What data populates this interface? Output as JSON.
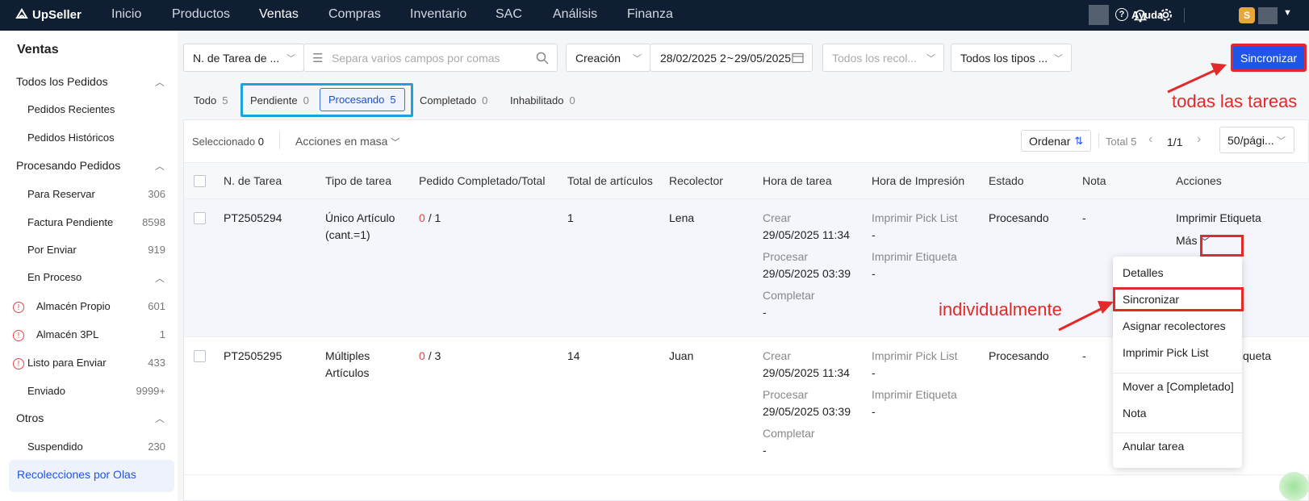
{
  "topbar": {
    "logo": "UpSeller",
    "nav": [
      "Inicio",
      "Productos",
      "Ventas",
      "Compras",
      "Inventario",
      "SAC",
      "Análisis",
      "Finanza"
    ],
    "help": "Ayuda",
    "user_badge": "S"
  },
  "sidebar": {
    "title": "Ventas",
    "items": [
      {
        "label": "Todos los Pedidos",
        "count": ""
      },
      {
        "label": "Pedidos Recientes",
        "count": ""
      },
      {
        "label": "Pedidos Históricos",
        "count": ""
      },
      {
        "label": "Procesando Pedidos",
        "count": ""
      },
      {
        "label": "Para Reservar",
        "count": "306"
      },
      {
        "label": "Factura Pendiente",
        "count": "8598"
      },
      {
        "label": "Por Enviar",
        "count": "919"
      },
      {
        "label": "En Proceso",
        "count": ""
      },
      {
        "label": "Almacén Propio",
        "count": "601"
      },
      {
        "label": "Almacén 3PL",
        "count": "1"
      },
      {
        "label": "Listo para Enviar",
        "count": "433"
      },
      {
        "label": "Enviado",
        "count": "9999+"
      },
      {
        "label": "Otros",
        "count": ""
      },
      {
        "label": "Suspendido",
        "count": "230"
      },
      {
        "label": "Recolecciones por Olas",
        "count": ""
      }
    ]
  },
  "filters": {
    "task_no": "N. de Tarea de ...",
    "search_placeholder": "Separa varios campos por comas",
    "date_type": "Creación",
    "date_start": "28/02/2025 2",
    "date_sep": "~",
    "date_end": "29/05/2025 2",
    "pickers": "Todos los recol...",
    "types": "Todos los tipos ...",
    "sync_button": "Sincronizar"
  },
  "tabs": [
    {
      "label": "Todo",
      "count": "5"
    },
    {
      "label": "Pendiente",
      "count": "0"
    },
    {
      "label": "Procesando",
      "count": "5"
    },
    {
      "label": "Completado",
      "count": "0"
    },
    {
      "label": "Inhabilitado",
      "count": "0"
    }
  ],
  "toolbar": {
    "selected_label": "Seleccionado",
    "selected_count": "0",
    "bulk_actions": "Acciones en masa",
    "order": "Ordenar",
    "total": "Total 5",
    "page": "1/1",
    "page_size": "50/pági..."
  },
  "table": {
    "headers": [
      "N. de Tarea",
      "Tipo de tarea",
      "Pedido Completado/Total",
      "Total de artículos",
      "Recolector",
      "Hora de tarea",
      "Hora de Impresión",
      "Estado",
      "Nota",
      "Acciones"
    ],
    "rows": [
      {
        "id": "PT2505294",
        "type1": "Único Artículo",
        "type2": "(cant.=1)",
        "done": "0",
        "total": "/ 1",
        "items": "1",
        "picker": "Lena",
        "create_lbl": "Crear",
        "create": "29/05/2025 11:34",
        "process_lbl": "Procesar",
        "process": "29/05/2025 03:39",
        "complete_lbl": "Completar",
        "complete": "-",
        "pl_lbl": "Imprimir Pick List",
        "pl": "-",
        "lbl_lbl": "Imprimir Etiqueta",
        "lbl": "-",
        "status": "Procesando",
        "note": "-",
        "action": "Imprimir Etiqueta",
        "more": "Más"
      },
      {
        "id": "PT2505295",
        "type1": "Múltiples",
        "type2": "Artículos",
        "done": "0",
        "total": "/ 3",
        "items": "14",
        "picker": "Juan",
        "create_lbl": "Crear",
        "create": "29/05/2025 11:34",
        "process_lbl": "Procesar",
        "process": "29/05/2025 03:39",
        "complete_lbl": "Completar",
        "complete": "-",
        "pl_lbl": "Imprimir Pick List",
        "pl": "-",
        "lbl_lbl": "Imprimir Etiqueta",
        "lbl": "-",
        "status": "Procesando",
        "note": "-",
        "action": "ir Etiqueta"
      }
    ]
  },
  "menu": [
    "Detalles",
    "Sincronizar",
    "Asignar recolectores",
    "Imprimir Pick List",
    "Mover a [Completado]",
    "Nota",
    "Anular tarea"
  ],
  "annotations": {
    "all_tasks": "todas las tareas",
    "individual": "individualmente"
  },
  "colors": {
    "accent": "#1f55e8",
    "annotation": "#e32929",
    "highlight": "#1aa3dc",
    "topbar": "#0f1e33"
  }
}
